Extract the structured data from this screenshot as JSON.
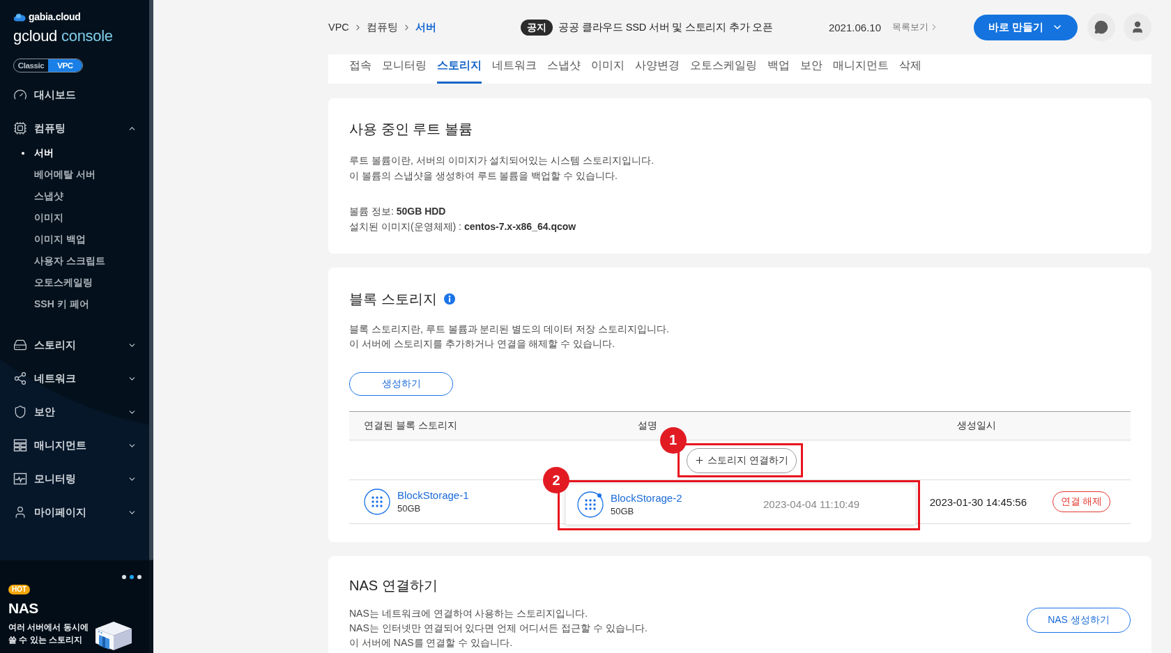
{
  "sidebar": {
    "brand": "gabia.cloud",
    "product": "gcloud",
    "product_suffix": "console",
    "toggle": [
      {
        "label": "Classic",
        "selected": false
      },
      {
        "label": "VPC",
        "selected": true
      }
    ],
    "nav": [
      {
        "kind": "link",
        "label": "대시보드"
      },
      {
        "kind": "group",
        "label": "컴퓨팅",
        "expanded": true,
        "children": [
          {
            "label": "서버",
            "selected": true
          },
          {
            "label": "베어메탈 서버",
            "selected": false
          },
          {
            "label": "스냅샷",
            "selected": false
          },
          {
            "label": "이미지",
            "selected": false
          },
          {
            "label": "이미지 백업",
            "selected": false
          },
          {
            "label": "사용자 스크립트",
            "selected": false
          },
          {
            "label": "오토스케일링",
            "selected": false
          },
          {
            "label": "SSH 키 페어",
            "selected": false
          }
        ]
      },
      {
        "kind": "group",
        "label": "스토리지",
        "expanded": false
      },
      {
        "kind": "group",
        "label": "네트워크",
        "expanded": false
      },
      {
        "kind": "group",
        "label": "보안",
        "expanded": false
      },
      {
        "kind": "group",
        "label": "매니지먼트",
        "expanded": false
      },
      {
        "kind": "group",
        "label": "모니터링",
        "expanded": false
      },
      {
        "kind": "group",
        "label": "마이페이지",
        "expanded": false
      }
    ],
    "promo": {
      "dots": [
        {
          "selected": false
        },
        {
          "selected": true
        },
        {
          "selected": false
        }
      ],
      "badge": "HOT",
      "title": "NAS",
      "text": "여러 서버에서 동시에 쓸 수 있는 스토리지"
    }
  },
  "header": {
    "breadcrumb": [
      {
        "label": "VPC",
        "current": false
      },
      {
        "label": "컴퓨팅",
        "current": false
      },
      {
        "label": "서버",
        "current": true
      }
    ],
    "notice": {
      "badge": "공지",
      "text": "공공 클라우드 SSD 서버 및 스토리지 추가 오픈",
      "date": "2021.06.10",
      "link": "목록보기"
    },
    "create_button": "바로 만들기"
  },
  "tabs": [
    {
      "label": "접속",
      "selected": false
    },
    {
      "label": "모니터링",
      "selected": false
    },
    {
      "label": "스토리지",
      "selected": true
    },
    {
      "label": "네트워크",
      "selected": false
    },
    {
      "label": "스냅샷",
      "selected": false
    },
    {
      "label": "이미지",
      "selected": false
    },
    {
      "label": "사양변경",
      "selected": false
    },
    {
      "label": "오토스케일링",
      "selected": false
    },
    {
      "label": "백업",
      "selected": false
    },
    {
      "label": "보안",
      "selected": false
    },
    {
      "label": "매니지먼트",
      "selected": false
    },
    {
      "label": "삭제",
      "selected": false
    }
  ],
  "root_volume": {
    "title": "사용 중인 루트 볼륨",
    "description": [
      "루트 볼륨이란, 서버의 이미지가 설치되어있는 시스템 스토리지입니다.",
      "이 볼륨의 스냅샷을 생성하여 루트 볼륨을 백업할 수 있습니다."
    ],
    "details": [
      "볼륨 정보: **50GB HDD**",
      "설치된 이미지(운영체제) : **centos-7.x-x86_64.qcow**"
    ]
  },
  "block_storage": {
    "title": "블록 스토리지",
    "description": [
      "블록 스토리지란, 루트 볼륨과 분리된 별도의 데이터 저장 스토리지입니다.",
      "이 서버에 스토리지를 추가하거나 연결을 해제할 수 있습니다."
    ],
    "create_button": "생성하기",
    "table": {
      "columns": [
        "연결된 블록 스토리지",
        "설명",
        "생성일시"
      ],
      "attach_button": {
        "label": "스토리지 연결하기",
        "callout": "1"
      },
      "rows": [
        {
          "name": "BlockStorage-1",
          "size": "50GB",
          "created": "2023-01-30 14:45:56",
          "action": "연결 해제"
        }
      ],
      "drag_preview": {
        "name": "BlockStorage-2",
        "size": "50GB",
        "created": "2023-04-04 11:10:49",
        "callout": "2"
      }
    }
  },
  "nas": {
    "title": "NAS 연결하기",
    "description": [
      "NAS는 네트워크에 연결하여 사용하는 스토리지입니다.",
      "NAS는 인터넷만 연결되어 있다면 언제 어디서든 접근할 수 있습니다.",
      "이 서버에 NAS를 연결할 수 있습니다."
    ],
    "create_button": "NAS 생성하기"
  }
}
